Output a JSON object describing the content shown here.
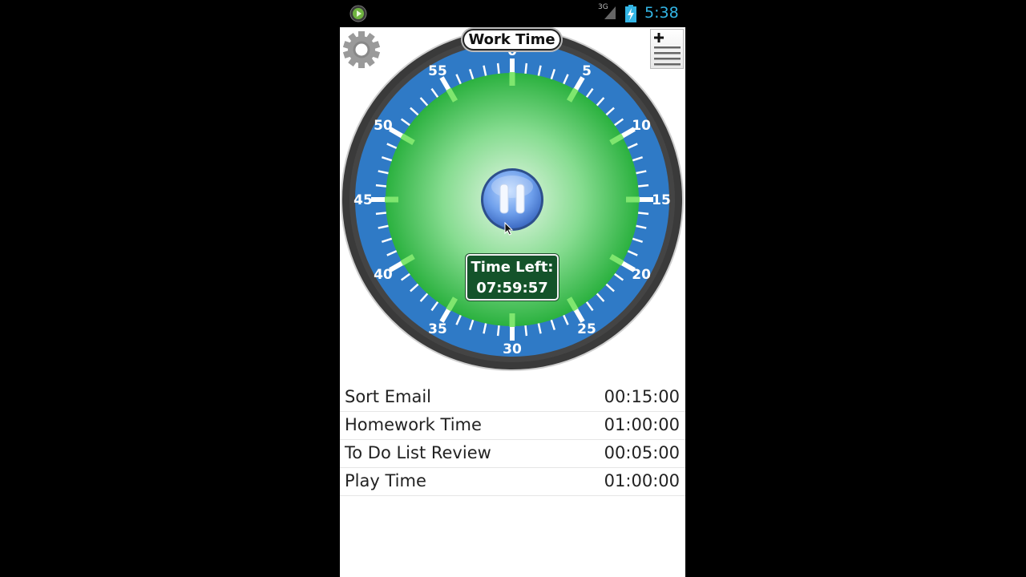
{
  "status_bar": {
    "time": "5:38",
    "network_label": "3G",
    "icons": [
      "play-store-notification-icon",
      "signal-icon",
      "battery-charging-icon"
    ]
  },
  "timer": {
    "title": "Work Time",
    "time_left_label": "Time Left:",
    "time_left_value": "07:59:57",
    "state": "running",
    "dial_labels": [
      "0",
      "5",
      "10",
      "15",
      "20",
      "25",
      "30",
      "35",
      "40",
      "45",
      "50",
      "55"
    ]
  },
  "toolbar": {
    "settings_icon": "gear-icon",
    "add_list_icon": "add-list-icon",
    "pause_icon": "pause-icon"
  },
  "timers": [
    {
      "name": "Sort Email",
      "duration": "00:15:00"
    },
    {
      "name": "Homework Time",
      "duration": "01:00:00"
    },
    {
      "name": "To Do List Review",
      "duration": "00:05:00"
    },
    {
      "name": "Play Time",
      "duration": "01:00:00"
    }
  ],
  "colors": {
    "accent_blue": "#2f7ac6",
    "dial_green": "#3cc352",
    "status_clock": "#33b5e5",
    "time_left_bg": "#14532a"
  }
}
